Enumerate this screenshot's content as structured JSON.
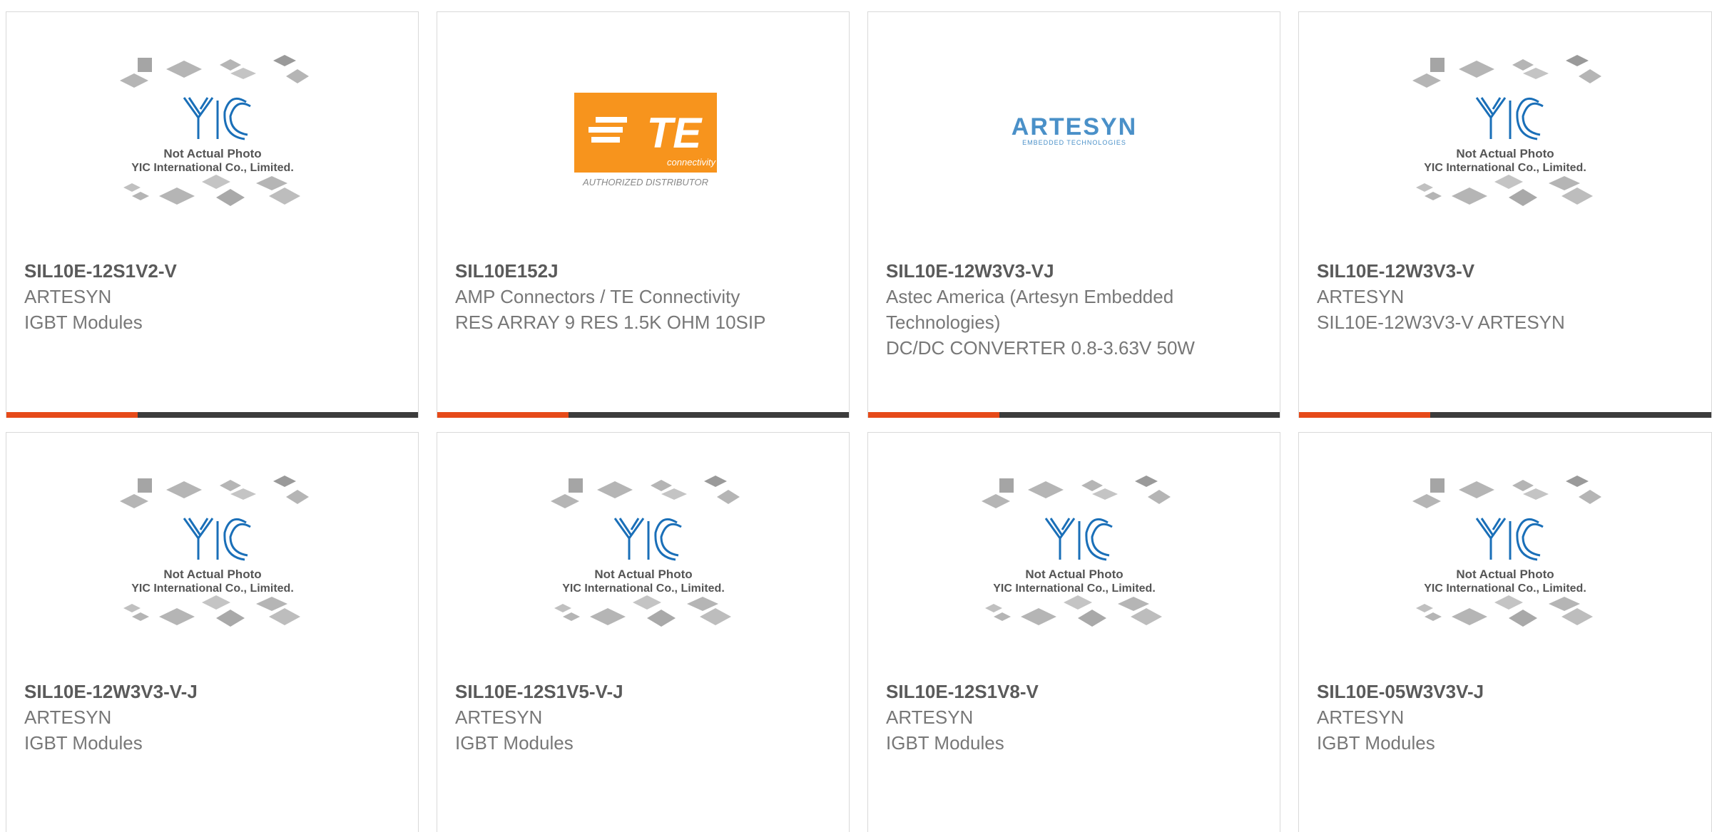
{
  "placeholder": {
    "line1": "Not Actual Photo",
    "line2": "YIC International Co., Limited."
  },
  "te_logo": {
    "brand": "TE",
    "sub": "connectivity",
    "caption": "AUTHORIZED DISTRIBUTOR"
  },
  "artesyn_logo": {
    "brand": "ARTESYN",
    "sub": "EMBEDDED TECHNOLOGIES"
  },
  "colors": {
    "accent": "#e64a19",
    "bar": "#3c3c3c",
    "te_orange": "#f7941d",
    "yic_blue": "#1a6fb8"
  },
  "products": [
    {
      "part": "SIL10E-12S1V2-V",
      "manufacturer": "ARTESYN",
      "description": "IGBT Modules",
      "image": "yic-placeholder"
    },
    {
      "part": "SIL10E152J",
      "manufacturer": "AMP Connectors / TE Connectivity",
      "description": "RES ARRAY 9 RES 1.5K OHM 10SIP",
      "image": "te-logo"
    },
    {
      "part": "SIL10E-12W3V3-VJ",
      "manufacturer": "Astec America (Artesyn Embedded Technologies)",
      "description": "DC/DC CONVERTER 0.8-3.63V 50W",
      "image": "artesyn-logo"
    },
    {
      "part": "SIL10E-12W3V3-V",
      "manufacturer": "ARTESYN",
      "description": "SIL10E-12W3V3-V ARTESYN",
      "image": "yic-placeholder"
    },
    {
      "part": "SIL10E-12W3V3-V-J",
      "manufacturer": "ARTESYN",
      "description": "IGBT Modules",
      "image": "yic-placeholder"
    },
    {
      "part": "SIL10E-12S1V5-V-J",
      "manufacturer": "ARTESYN",
      "description": "IGBT Modules",
      "image": "yic-placeholder"
    },
    {
      "part": "SIL10E-12S1V8-V",
      "manufacturer": "ARTESYN",
      "description": "IGBT Modules",
      "image": "yic-placeholder"
    },
    {
      "part": "SIL10E-05W3V3V-J",
      "manufacturer": "ARTESYN",
      "description": "IGBT Modules",
      "image": "yic-placeholder"
    }
  ]
}
